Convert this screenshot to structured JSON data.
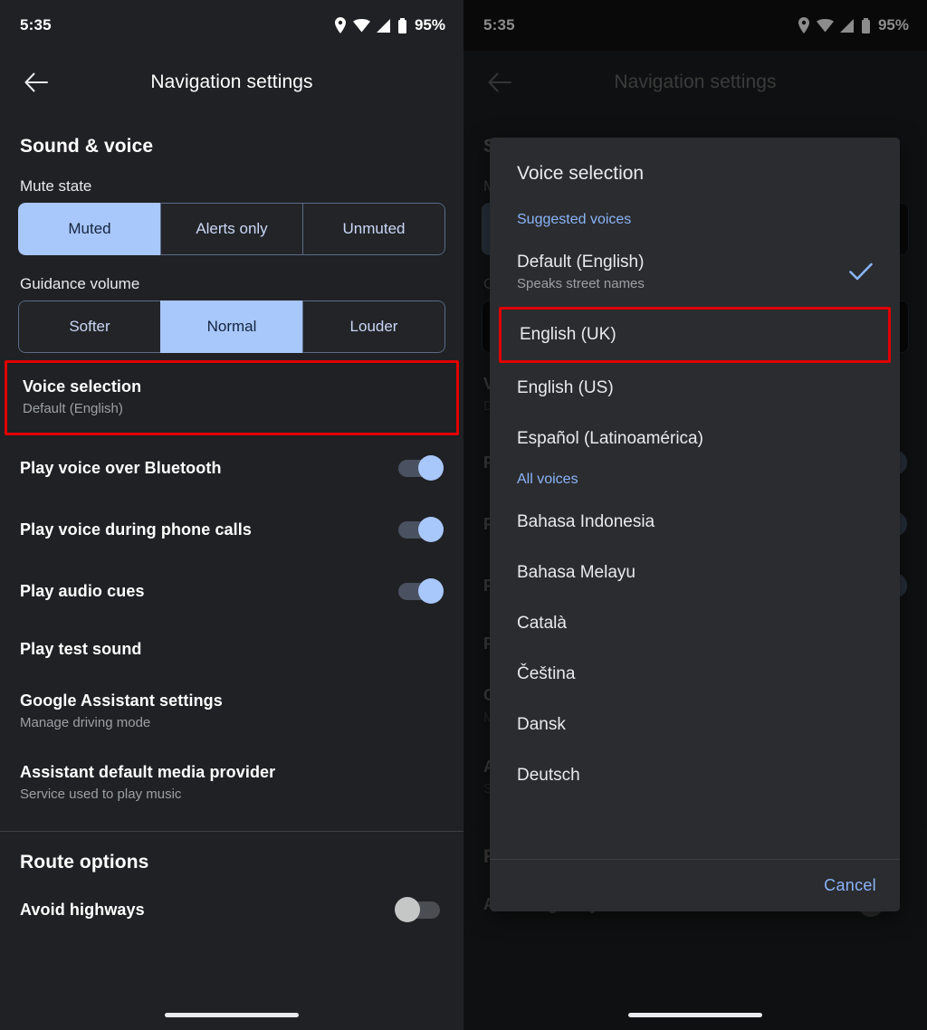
{
  "status": {
    "time": "5:35",
    "battery": "95%",
    "icons": [
      "location-icon",
      "wifi-icon",
      "signal-icon",
      "battery-icon"
    ]
  },
  "appbar": {
    "title": "Navigation settings",
    "back_icon": "arrow-left-icon"
  },
  "sound_section": {
    "title": "Sound & voice",
    "mute_state": {
      "label": "Mute state",
      "options": [
        "Muted",
        "Alerts only",
        "Unmuted"
      ],
      "selected": "Muted"
    },
    "guidance_volume": {
      "label": "Guidance volume",
      "options": [
        "Softer",
        "Normal",
        "Louder"
      ],
      "selected": "Normal"
    },
    "voice_selection": {
      "title": "Voice selection",
      "subtitle": "Default (English)",
      "highlighted": true
    },
    "toggles": [
      {
        "title": "Play voice over Bluetooth",
        "state": "on"
      },
      {
        "title": "Play voice during phone calls",
        "state": "on"
      },
      {
        "title": "Play audio cues",
        "state": "on"
      }
    ],
    "play_test_sound": {
      "title": "Play test sound"
    },
    "assistant_settings": {
      "title": "Google Assistant settings",
      "subtitle": "Manage driving mode"
    },
    "media_provider": {
      "title": "Assistant default media provider",
      "subtitle": "Service used to play music"
    }
  },
  "route_section": {
    "title": "Route options",
    "avoid_highways": {
      "title": "Avoid highways",
      "state": "off"
    }
  },
  "dialog": {
    "title": "Voice selection",
    "groups": [
      {
        "header": "Suggested voices",
        "items": [
          {
            "label": "Default (English)",
            "sub": "Speaks street names",
            "checked": true,
            "highlighted": false
          },
          {
            "label": "English (UK)",
            "sub": "",
            "checked": false,
            "highlighted": true
          },
          {
            "label": "English (US)",
            "sub": "",
            "checked": false,
            "highlighted": false
          },
          {
            "label": "Español (Latinoamérica)",
            "sub": "",
            "checked": false,
            "highlighted": false
          }
        ]
      },
      {
        "header": "All voices",
        "items": [
          {
            "label": "Bahasa Indonesia",
            "sub": "",
            "checked": false,
            "highlighted": false
          },
          {
            "label": "Bahasa Melayu",
            "sub": "",
            "checked": false,
            "highlighted": false
          },
          {
            "label": "Català",
            "sub": "",
            "checked": false,
            "highlighted": false
          },
          {
            "label": "Čeština",
            "sub": "",
            "checked": false,
            "highlighted": false
          },
          {
            "label": "Dansk",
            "sub": "",
            "checked": false,
            "highlighted": false
          },
          {
            "label": "Deutsch",
            "sub": "",
            "checked": false,
            "highlighted": false
          }
        ]
      }
    ],
    "cancel_label": "Cancel",
    "check_icon": "check-icon"
  },
  "colors": {
    "accent_blue": "#8ab4f8",
    "selected_segment": "#a8c7fa",
    "highlight_red": "#e00000",
    "surface": "#202124",
    "dialog_surface": "#2b2c2f"
  }
}
